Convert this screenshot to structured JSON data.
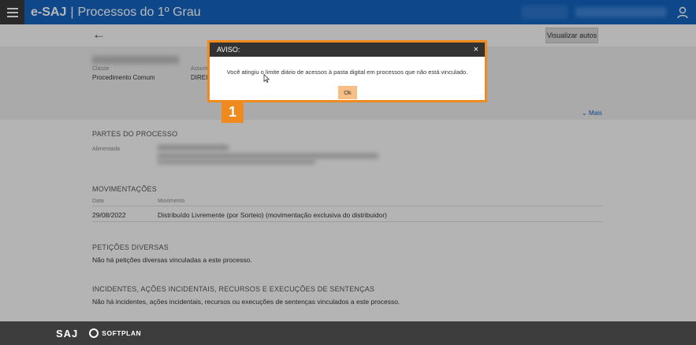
{
  "topbar": {
    "brand": "e-SAJ",
    "separator": "|",
    "subtitle": "Processos do 1º Grau"
  },
  "toolbar": {
    "view_autos_label": "Visualizar autos"
  },
  "header": {
    "fields": [
      {
        "label": "Classe",
        "value": "Procedimento Comum"
      },
      {
        "label": "Assunto",
        "value": "DIREIT"
      }
    ],
    "more_label": "Mais"
  },
  "partes": {
    "title": "PARTES DO PROCESSO",
    "role_label": "Alimentada"
  },
  "movimentacoes": {
    "title": "MOVIMENTAÇÕES",
    "col_date": "Data",
    "col_movement": "Movimento",
    "rows": [
      {
        "date": "29/08/2022",
        "text": "Distribuído Livremente (por Sorteio) (movimentação exclusiva do distribuidor)"
      }
    ]
  },
  "peticoes": {
    "title": "PETIÇÕES DIVERSAS",
    "empty_text": "Não há petições diversas vinculadas a este processo."
  },
  "incidentes": {
    "title": "INCIDENTES, AÇÕES INCIDENTAIS, RECURSOS E EXECUÇÕES DE SENTENÇAS",
    "empty_text": "Não há incidentes, ações incidentais, recursos ou execuções de sentenças vinculados a este processo."
  },
  "modal": {
    "title": "AVISO:",
    "close": "×",
    "message": "Você atingiu o limite diário de acessos à pasta digital em processos que não está vinculado.",
    "ok_label": "Ok"
  },
  "annotation": {
    "step": "1"
  },
  "footer": {
    "saj_logo": "SAJ",
    "softplan_logo": "SOFTPLAN"
  },
  "colors": {
    "brand_blue": "#1565c0",
    "highlight_orange": "#f08a1c",
    "ok_button": "#f7bf86"
  }
}
